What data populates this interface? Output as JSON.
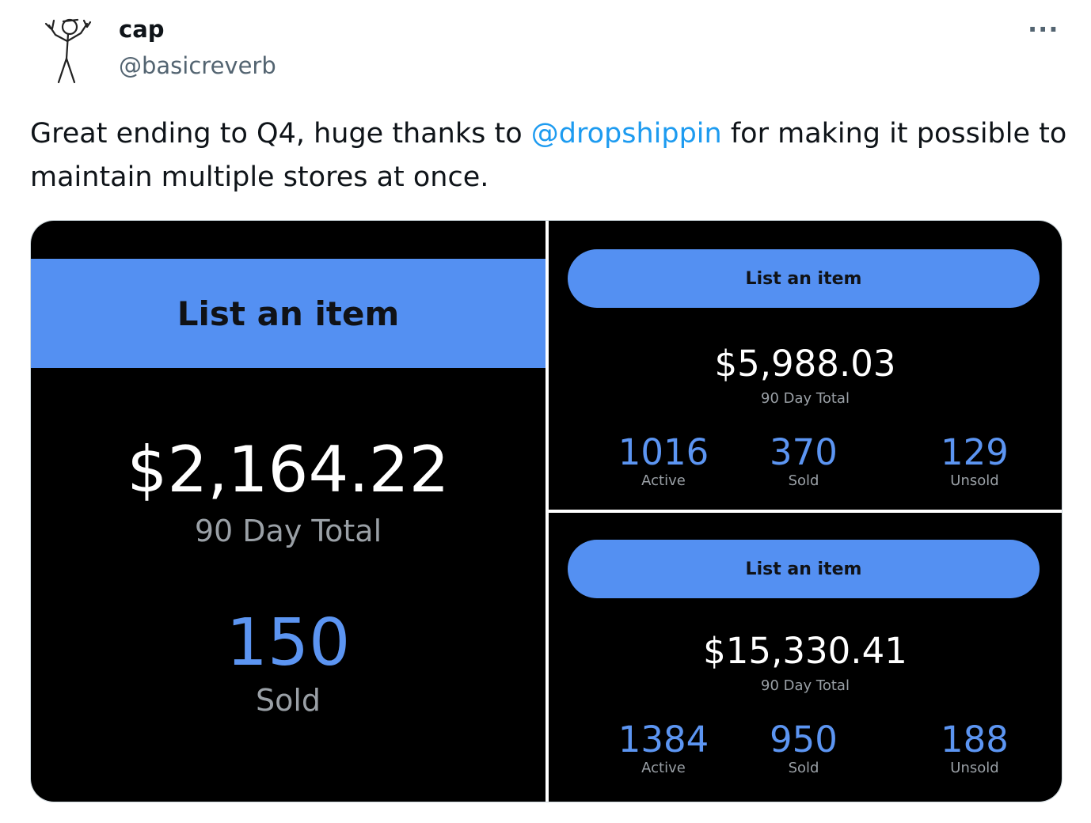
{
  "tweet": {
    "author_name": "cap",
    "author_handle": "@basicreverb",
    "more_label": "···",
    "text_before": "Great ending to Q4, huge thanks to ",
    "mention": "@dropshippin",
    "text_after": " for making it possible to maintain multiple stores at once."
  },
  "media": {
    "left": {
      "button_label": "List an item",
      "total": "$2,164.22",
      "total_label": "90 Day Total",
      "sold": "150",
      "sold_label": "Sold"
    },
    "top_right": {
      "button_label": "List an item",
      "total": "$5,988.03",
      "total_label": "90 Day Total",
      "stats": [
        {
          "value": "1016",
          "label": "Active"
        },
        {
          "value": "370",
          "label": "Sold"
        },
        {
          "value": "129",
          "label": "Unsold"
        }
      ]
    },
    "bottom_right": {
      "button_label": "List an item",
      "total": "$15,330.41",
      "total_label": "90 Day Total",
      "stats": [
        {
          "value": "1384",
          "label": "Active"
        },
        {
          "value": "950",
          "label": "Sold"
        },
        {
          "value": "188",
          "label": "Unsold"
        }
      ]
    }
  },
  "colors": {
    "accent_blue": "#5490f2",
    "stat_blue": "#5c95f2",
    "mention_blue": "#1d9bf0",
    "panel_bg": "#000000"
  },
  "icons": {
    "avatar": "stick-figure-avatar",
    "more": "more-horizontal-icon"
  }
}
